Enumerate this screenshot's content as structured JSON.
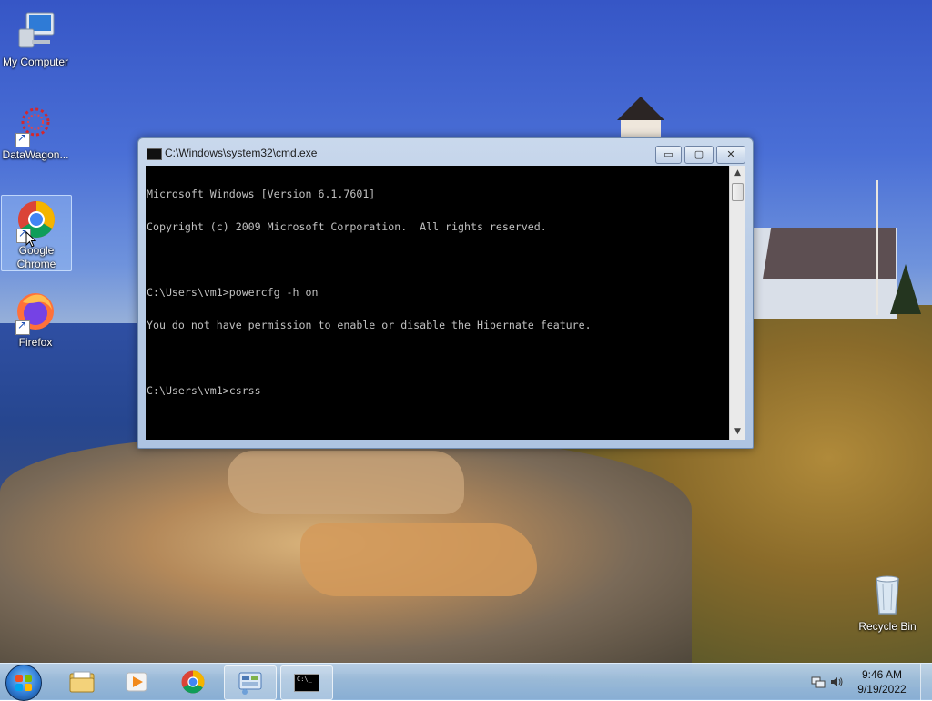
{
  "desktop": {
    "icons": [
      {
        "label": "My Computer",
        "icon": "computer-icon"
      },
      {
        "label": "DataWagon...",
        "icon": "datawagon-icon"
      },
      {
        "label": "Google Chrome",
        "icon": "chrome-icon"
      },
      {
        "label": "Firefox",
        "icon": "firefox-icon"
      },
      {
        "label": "Recycle Bin",
        "icon": "recycle-bin-icon"
      }
    ]
  },
  "cmd_window": {
    "title": "C:\\Windows\\system32\\cmd.exe",
    "minimize_glyph": "▭",
    "maximize_glyph": "▢",
    "close_glyph": "✕",
    "lines": [
      "Microsoft Windows [Version 6.1.7601]",
      "Copyright (c) 2009 Microsoft Corporation.  All rights reserved.",
      "",
      "C:\\Users\\vm1>powercfg -h on",
      "You do not have permission to enable or disable the Hibernate feature.",
      "",
      "C:\\Users\\vm1>csrss"
    ],
    "scroll_up_glyph": "▲",
    "scroll_down_glyph": "▼"
  },
  "taskbar": {
    "items": [
      {
        "name": "explorer",
        "icon": "folder-icon"
      },
      {
        "name": "media-player",
        "icon": "media-player-icon"
      },
      {
        "name": "chrome",
        "icon": "chrome-icon"
      },
      {
        "name": "control-panel",
        "icon": "control-panel-icon"
      },
      {
        "name": "cmd",
        "icon": "cmd-icon",
        "active": true
      }
    ],
    "cmd_glyph_text": "C:\\_",
    "clock": {
      "time": "9:46 AM",
      "date": "9/19/2022"
    }
  }
}
